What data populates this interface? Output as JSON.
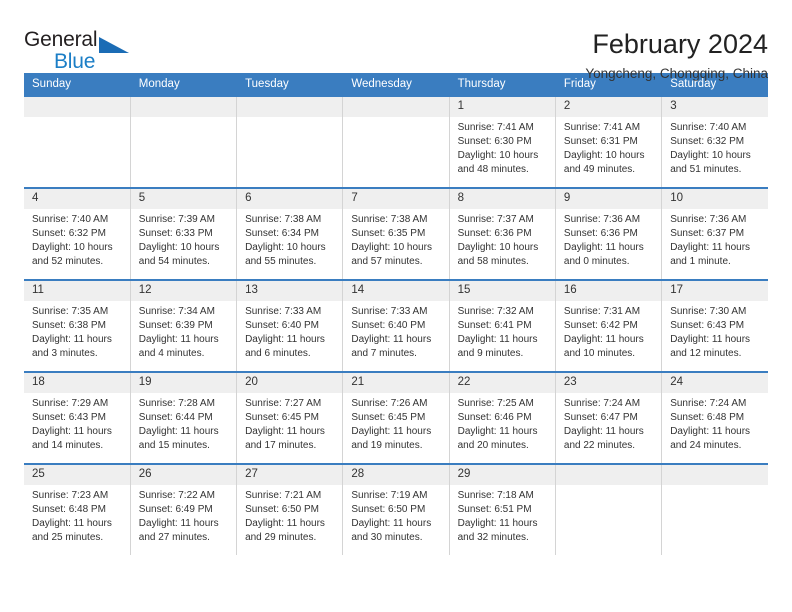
{
  "brand": {
    "name_part1": "General",
    "name_part2": "Blue",
    "accent_color": "#1b7ec6",
    "triangle_color": "#1b6cb5"
  },
  "header": {
    "title": "February 2024",
    "subtitle": "Yongcheng, Chongqing, China"
  },
  "theme": {
    "header_row_bg": "#3a7dc0",
    "day_number_bg": "#efefef",
    "cell_bg": "#ffffff",
    "text_color": "#333333"
  },
  "weekdays": [
    "Sunday",
    "Monday",
    "Tuesday",
    "Wednesday",
    "Thursday",
    "Friday",
    "Saturday"
  ],
  "labels": {
    "sunrise_prefix": "Sunrise:",
    "sunset_prefix": "Sunset:",
    "daylight_prefix": "Daylight:"
  },
  "weeks": [
    [
      {
        "day": "",
        "sunrise": "",
        "sunset": "",
        "daylight": ""
      },
      {
        "day": "",
        "sunrise": "",
        "sunset": "",
        "daylight": ""
      },
      {
        "day": "",
        "sunrise": "",
        "sunset": "",
        "daylight": ""
      },
      {
        "day": "",
        "sunrise": "",
        "sunset": "",
        "daylight": ""
      },
      {
        "day": "1",
        "sunrise": "Sunrise: 7:41 AM",
        "sunset": "Sunset: 6:30 PM",
        "daylight": "Daylight: 10 hours and 48 minutes."
      },
      {
        "day": "2",
        "sunrise": "Sunrise: 7:41 AM",
        "sunset": "Sunset: 6:31 PM",
        "daylight": "Daylight: 10 hours and 49 minutes."
      },
      {
        "day": "3",
        "sunrise": "Sunrise: 7:40 AM",
        "sunset": "Sunset: 6:32 PM",
        "daylight": "Daylight: 10 hours and 51 minutes."
      }
    ],
    [
      {
        "day": "4",
        "sunrise": "Sunrise: 7:40 AM",
        "sunset": "Sunset: 6:32 PM",
        "daylight": "Daylight: 10 hours and 52 minutes."
      },
      {
        "day": "5",
        "sunrise": "Sunrise: 7:39 AM",
        "sunset": "Sunset: 6:33 PM",
        "daylight": "Daylight: 10 hours and 54 minutes."
      },
      {
        "day": "6",
        "sunrise": "Sunrise: 7:38 AM",
        "sunset": "Sunset: 6:34 PM",
        "daylight": "Daylight: 10 hours and 55 minutes."
      },
      {
        "day": "7",
        "sunrise": "Sunrise: 7:38 AM",
        "sunset": "Sunset: 6:35 PM",
        "daylight": "Daylight: 10 hours and 57 minutes."
      },
      {
        "day": "8",
        "sunrise": "Sunrise: 7:37 AM",
        "sunset": "Sunset: 6:36 PM",
        "daylight": "Daylight: 10 hours and 58 minutes."
      },
      {
        "day": "9",
        "sunrise": "Sunrise: 7:36 AM",
        "sunset": "Sunset: 6:36 PM",
        "daylight": "Daylight: 11 hours and 0 minutes."
      },
      {
        "day": "10",
        "sunrise": "Sunrise: 7:36 AM",
        "sunset": "Sunset: 6:37 PM",
        "daylight": "Daylight: 11 hours and 1 minute."
      }
    ],
    [
      {
        "day": "11",
        "sunrise": "Sunrise: 7:35 AM",
        "sunset": "Sunset: 6:38 PM",
        "daylight": "Daylight: 11 hours and 3 minutes."
      },
      {
        "day": "12",
        "sunrise": "Sunrise: 7:34 AM",
        "sunset": "Sunset: 6:39 PM",
        "daylight": "Daylight: 11 hours and 4 minutes."
      },
      {
        "day": "13",
        "sunrise": "Sunrise: 7:33 AM",
        "sunset": "Sunset: 6:40 PM",
        "daylight": "Daylight: 11 hours and 6 minutes."
      },
      {
        "day": "14",
        "sunrise": "Sunrise: 7:33 AM",
        "sunset": "Sunset: 6:40 PM",
        "daylight": "Daylight: 11 hours and 7 minutes."
      },
      {
        "day": "15",
        "sunrise": "Sunrise: 7:32 AM",
        "sunset": "Sunset: 6:41 PM",
        "daylight": "Daylight: 11 hours and 9 minutes."
      },
      {
        "day": "16",
        "sunrise": "Sunrise: 7:31 AM",
        "sunset": "Sunset: 6:42 PM",
        "daylight": "Daylight: 11 hours and 10 minutes."
      },
      {
        "day": "17",
        "sunrise": "Sunrise: 7:30 AM",
        "sunset": "Sunset: 6:43 PM",
        "daylight": "Daylight: 11 hours and 12 minutes."
      }
    ],
    [
      {
        "day": "18",
        "sunrise": "Sunrise: 7:29 AM",
        "sunset": "Sunset: 6:43 PM",
        "daylight": "Daylight: 11 hours and 14 minutes."
      },
      {
        "day": "19",
        "sunrise": "Sunrise: 7:28 AM",
        "sunset": "Sunset: 6:44 PM",
        "daylight": "Daylight: 11 hours and 15 minutes."
      },
      {
        "day": "20",
        "sunrise": "Sunrise: 7:27 AM",
        "sunset": "Sunset: 6:45 PM",
        "daylight": "Daylight: 11 hours and 17 minutes."
      },
      {
        "day": "21",
        "sunrise": "Sunrise: 7:26 AM",
        "sunset": "Sunset: 6:45 PM",
        "daylight": "Daylight: 11 hours and 19 minutes."
      },
      {
        "day": "22",
        "sunrise": "Sunrise: 7:25 AM",
        "sunset": "Sunset: 6:46 PM",
        "daylight": "Daylight: 11 hours and 20 minutes."
      },
      {
        "day": "23",
        "sunrise": "Sunrise: 7:24 AM",
        "sunset": "Sunset: 6:47 PM",
        "daylight": "Daylight: 11 hours and 22 minutes."
      },
      {
        "day": "24",
        "sunrise": "Sunrise: 7:24 AM",
        "sunset": "Sunset: 6:48 PM",
        "daylight": "Daylight: 11 hours and 24 minutes."
      }
    ],
    [
      {
        "day": "25",
        "sunrise": "Sunrise: 7:23 AM",
        "sunset": "Sunset: 6:48 PM",
        "daylight": "Daylight: 11 hours and 25 minutes."
      },
      {
        "day": "26",
        "sunrise": "Sunrise: 7:22 AM",
        "sunset": "Sunset: 6:49 PM",
        "daylight": "Daylight: 11 hours and 27 minutes."
      },
      {
        "day": "27",
        "sunrise": "Sunrise: 7:21 AM",
        "sunset": "Sunset: 6:50 PM",
        "daylight": "Daylight: 11 hours and 29 minutes."
      },
      {
        "day": "28",
        "sunrise": "Sunrise: 7:19 AM",
        "sunset": "Sunset: 6:50 PM",
        "daylight": "Daylight: 11 hours and 30 minutes."
      },
      {
        "day": "29",
        "sunrise": "Sunrise: 7:18 AM",
        "sunset": "Sunset: 6:51 PM",
        "daylight": "Daylight: 11 hours and 32 minutes."
      },
      {
        "day": "",
        "sunrise": "",
        "sunset": "",
        "daylight": ""
      },
      {
        "day": "",
        "sunrise": "",
        "sunset": "",
        "daylight": ""
      }
    ]
  ]
}
